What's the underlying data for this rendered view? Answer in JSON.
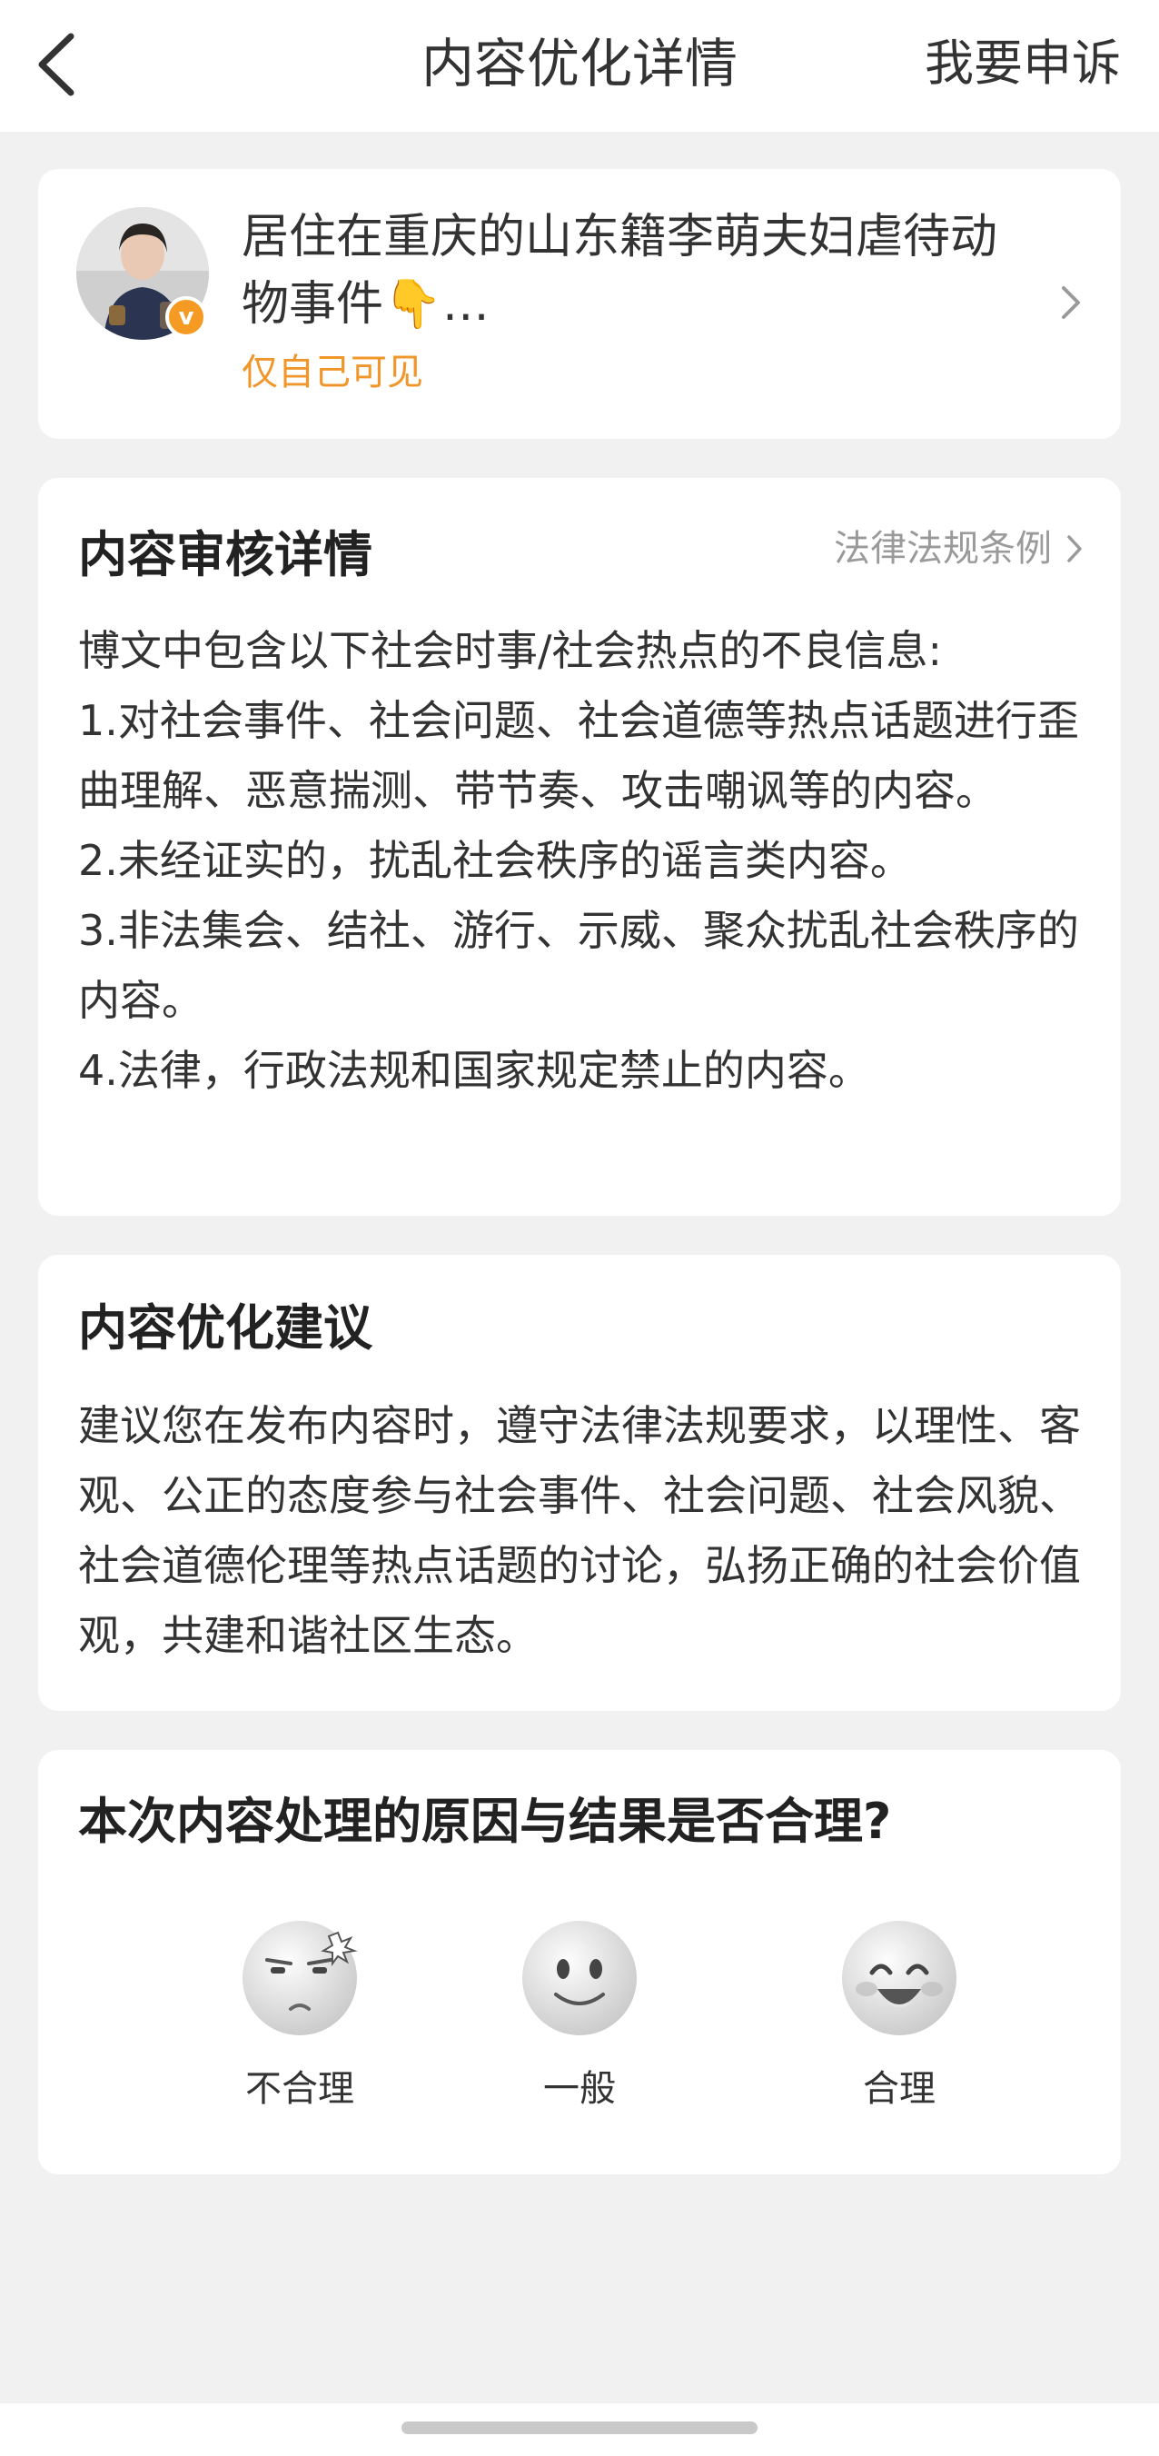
{
  "header": {
    "title": "内容优化详情",
    "appeal_label": "我要申诉",
    "back_icon": "chevron-left-icon"
  },
  "post": {
    "title": "居住在重庆的山东籍李萌夫妇虐待动物事件👇…",
    "visibility": "仅自己可见",
    "badge": "v",
    "avatar_icon": "user-avatar"
  },
  "review": {
    "title": "内容审核详情",
    "law_link": "法律法规条例",
    "lines": [
      "博文中包含以下社会时事/社会热点的不良信息:",
      "1.对社会事件、社会问题、社会道德等热点话题进行歪曲理解、恶意揣测、带节奏、攻击嘲讽等的内容。",
      "2.未经证实的，扰乱社会秩序的谣言类内容。",
      "3.非法集会、结社、游行、示威、聚众扰乱社会秩序的内容。",
      "4.法律，行政法规和国家规定禁止的内容。"
    ]
  },
  "advice": {
    "title": "内容优化建议",
    "text": "建议您在发布内容时，遵守法律法规要求，以理性、客观、公正的态度参与社会事件、社会问题、社会风貌、社会道德伦理等热点话题的讨论，弘扬正确的社会价值观，共建和谐社区生态。"
  },
  "feedback": {
    "question": "本次内容处理的原因与结果是否合理?",
    "options": [
      {
        "label": "不合理",
        "icon": "angry-face-icon"
      },
      {
        "label": "一般",
        "icon": "neutral-face-icon"
      },
      {
        "label": "合理",
        "icon": "happy-face-icon"
      }
    ]
  },
  "colors": {
    "accent_orange": "#f0962b",
    "muted_gray": "#9a9a9a",
    "background": "#f1f1f1"
  }
}
